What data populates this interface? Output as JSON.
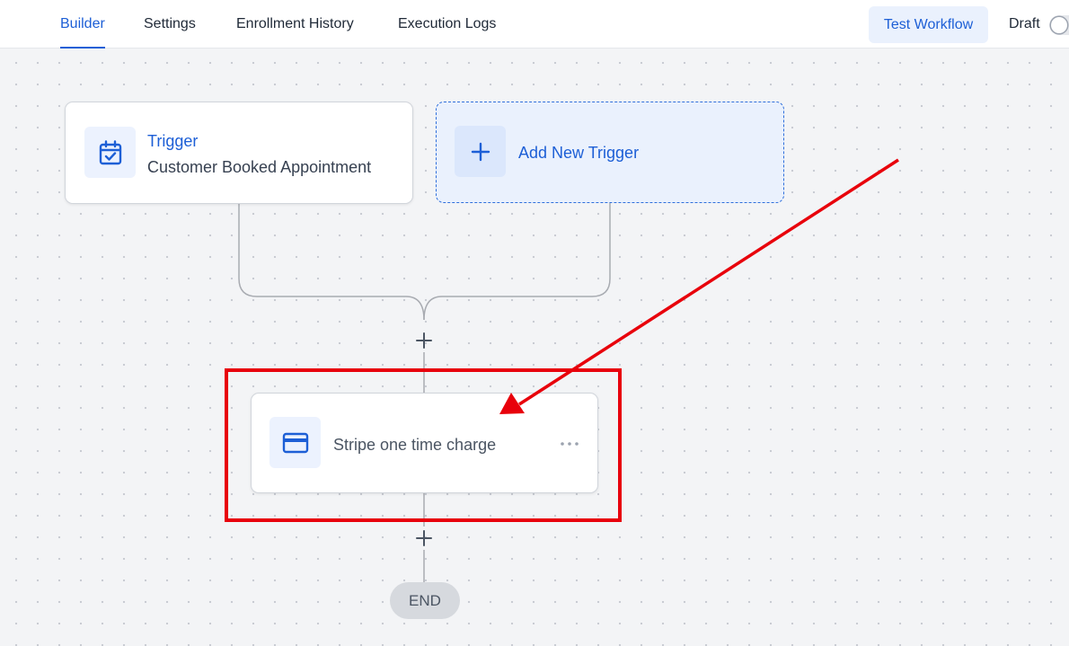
{
  "tabs": [
    {
      "label": "Builder",
      "active": true
    },
    {
      "label": "Settings",
      "active": false
    },
    {
      "label": "Enrollment History",
      "active": false
    },
    {
      "label": "Execution Logs",
      "active": false
    }
  ],
  "header": {
    "test_button_label": "Test Workflow",
    "status_label": "Draft",
    "published": false
  },
  "trigger_card": {
    "title": "Trigger",
    "subtitle": "Customer Booked Appointment",
    "icon": "calendar-check-icon"
  },
  "add_trigger": {
    "label": "Add New Trigger",
    "icon": "plus-icon"
  },
  "action_card": {
    "label": "Stripe one time charge",
    "icon": "credit-card-icon",
    "menu_icon": "more-horizontal-icon"
  },
  "end_node": {
    "label": "END"
  },
  "colors": {
    "accent": "#1d5fd6",
    "annotation": "#e8000b",
    "canvas": "#f3f4f6",
    "connector": "#a8abb1"
  }
}
